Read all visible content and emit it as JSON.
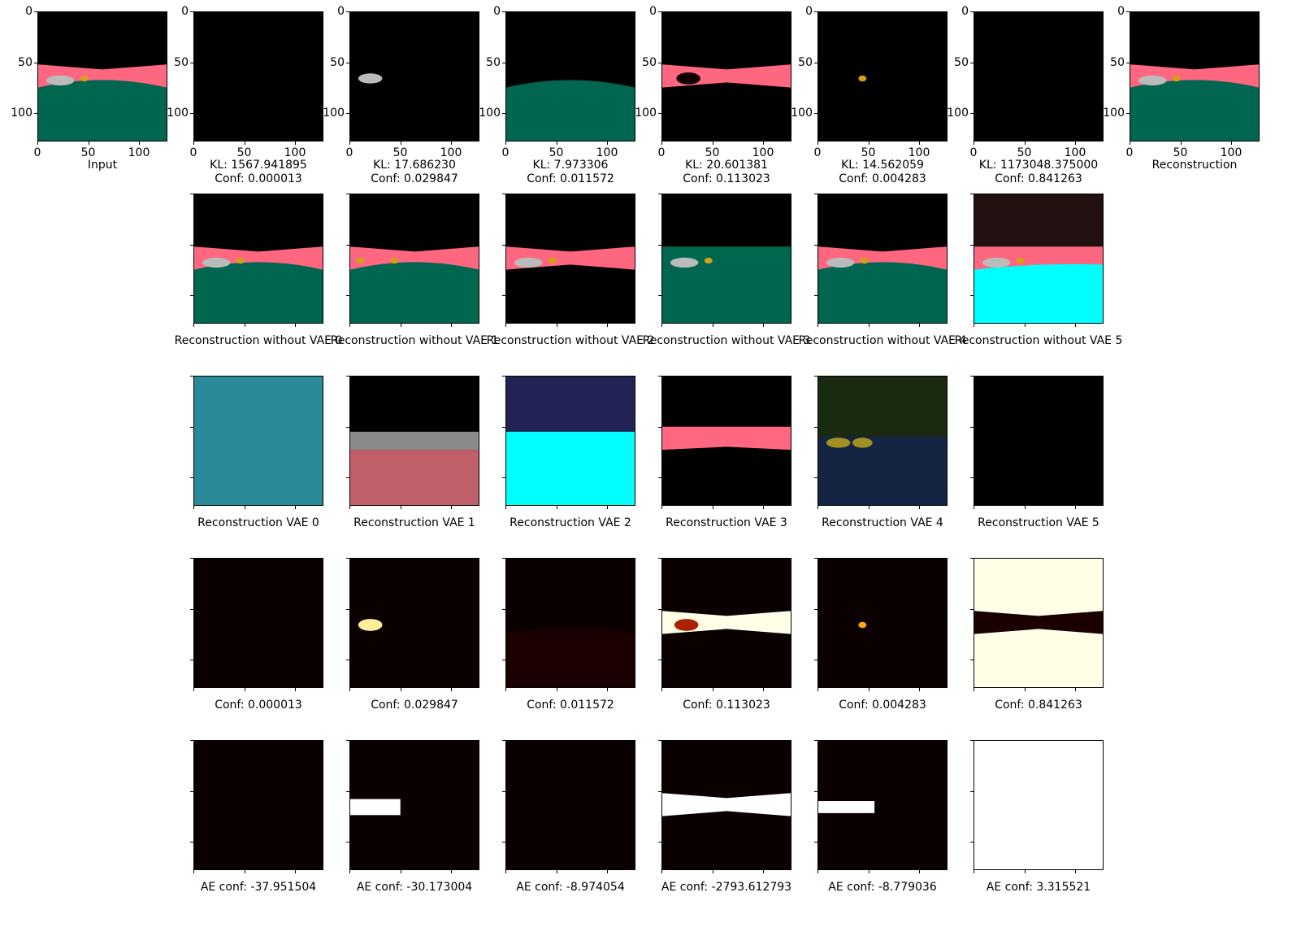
{
  "row0": {
    "tick_labels_y": [
      "0",
      "50",
      "100"
    ],
    "tick_labels_x": [
      "0",
      "50",
      "100"
    ],
    "panels": [
      {
        "caption": "Input"
      },
      {
        "caption": "KL: 1567.941895\nConf: 0.000013"
      },
      {
        "caption": "KL: 17.686230\nConf: 0.029847"
      },
      {
        "caption": "KL: 7.973306\nConf: 0.011572"
      },
      {
        "caption": "KL: 20.601381\nConf: 0.113023"
      },
      {
        "caption": "KL: 14.562059\nConf: 0.004283"
      },
      {
        "caption": "KL: 1173048.375000\nConf: 0.841263"
      },
      {
        "caption": "Reconstruction"
      }
    ]
  },
  "row1": [
    "Reconstruction without VAE 0",
    "Reconstruction without VAE 1",
    "Reconstruction without VAE 2",
    "Reconstruction without VAE 3",
    "Reconstruction without VAE 4",
    "Reconstruction without VAE 5"
  ],
  "row2": [
    "Reconstruction VAE 0",
    "Reconstruction VAE 1",
    "Reconstruction VAE 2",
    "Reconstruction VAE 3",
    "Reconstruction VAE 4",
    "Reconstruction VAE 5"
  ],
  "row3": [
    "Conf: 0.000013",
    "Conf: 0.029847",
    "Conf: 0.011572",
    "Conf: 0.113023",
    "Conf: 0.004283",
    "Conf: 0.841263"
  ],
  "row4": [
    "AE conf: -37.951504",
    "AE conf: -30.173004",
    "AE conf: -8.974054",
    "AE conf: -2793.612793",
    "AE conf: -8.779036",
    "AE conf: 3.315521"
  ],
  "colors": {
    "black": "#000000",
    "pink": "#ff6680",
    "green": "#006650",
    "cyan": "#00ffff",
    "dark_red": "#1a0000",
    "cream": "#ffffe8",
    "white": "#ffffff"
  }
}
